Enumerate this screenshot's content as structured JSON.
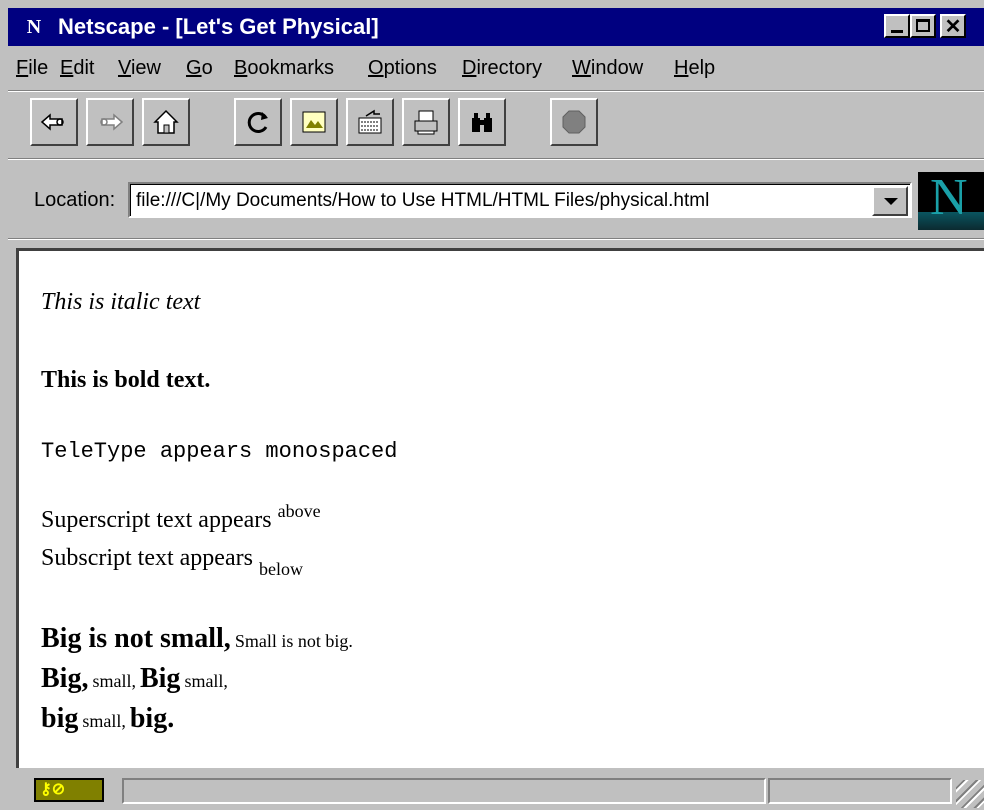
{
  "window": {
    "title": "Netscape - [Let's Get Physical]",
    "icon": "netscape-n-icon"
  },
  "menu": [
    "File",
    "Edit",
    "View",
    "Go",
    "Bookmarks",
    "Options",
    "Directory",
    "Window",
    "Help"
  ],
  "toolbar": {
    "buttons": [
      {
        "name": "back",
        "icon": "back-arrow-icon"
      },
      {
        "name": "forward",
        "icon": "forward-arrow-icon"
      },
      {
        "name": "home",
        "icon": "home-icon"
      },
      {
        "name": "reload",
        "icon": "reload-icon"
      },
      {
        "name": "images",
        "icon": "images-icon"
      },
      {
        "name": "open",
        "icon": "open-icon"
      },
      {
        "name": "print",
        "icon": "print-icon"
      },
      {
        "name": "find",
        "icon": "binoculars-icon"
      },
      {
        "name": "stop",
        "icon": "stop-icon"
      }
    ]
  },
  "location": {
    "label": "Location:",
    "value": "file:///C|/My Documents/How to Use HTML/HTML Files/physical.html"
  },
  "content": {
    "italic": "This is italic text",
    "bold": "This is bold text.",
    "teletype": "TeleType appears monospaced",
    "superscript_text": "Superscript text appears",
    "superscript_word": "above",
    "subscript_text": "Subscript text appears",
    "subscript_word": "below",
    "line1_big": "Big is not small,",
    "line1_small": "Small is not big.",
    "line2_a": "Big,",
    "line2_b": "small,",
    "line2_c": "Big",
    "line2_d": "small,",
    "line3_a": "big",
    "line3_b": "small,",
    "line3_c": "big."
  },
  "status": {
    "icon": "security-key-icon",
    "text": ""
  }
}
